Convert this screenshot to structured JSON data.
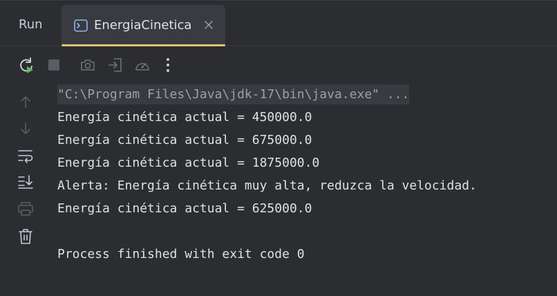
{
  "panel": {
    "title": "Run"
  },
  "tab": {
    "label": "EnergiaCinetica",
    "active": true,
    "accent_color": "#e3c26f"
  },
  "toolbar": {
    "rerun": "rerun-icon",
    "stop": "stop-icon",
    "screenshot": "camera-icon",
    "restore": "exit-icon",
    "profiler": "gauge-icon",
    "more": "more-vertical-icon"
  },
  "sidebar": {
    "up": "arrow-up-icon",
    "down": "arrow-down-icon",
    "soft_wrap": "soft-wrap-icon",
    "scroll_end": "scroll-to-end-icon",
    "print": "print-icon",
    "clear": "trash-icon"
  },
  "console": {
    "command": "\"C:\\Program Files\\Java\\jdk-17\\bin\\java.exe\" ...",
    "lines": [
      "Energía cinética actual = 450000.0",
      "Energía cinética actual = 675000.0",
      "Energía cinética actual = 1875000.0",
      "Alerta: Energía cinética muy alta, reduzca la velocidad.",
      "Energía cinética actual = 625000.0",
      "",
      "Process finished with exit code 0"
    ]
  }
}
